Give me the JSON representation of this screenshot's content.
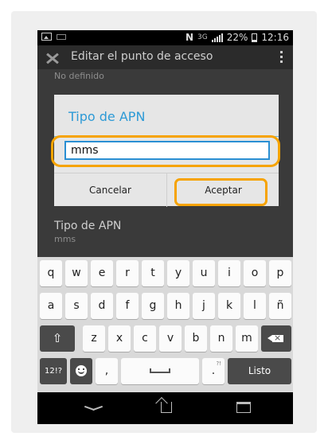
{
  "status_bar": {
    "network": "3G",
    "battery": "22%",
    "time": "12:16"
  },
  "app_bar": {
    "title": "Editar el punto de acceso",
    "icon": "wrench-screwdriver-icon"
  },
  "background": {
    "subtitle_text": "No definido",
    "list_item_title": "Tipo de APN",
    "list_item_value": "mms"
  },
  "dialog": {
    "title": "Tipo de APN",
    "input_value": "mms",
    "cancel_label": "Cancelar",
    "accept_label": "Aceptar"
  },
  "keyboard": {
    "row1": [
      "q",
      "w",
      "e",
      "r",
      "t",
      "y",
      "u",
      "i",
      "o",
      "p"
    ],
    "row2": [
      "a",
      "s",
      "d",
      "f",
      "g",
      "h",
      "j",
      "k",
      "l",
      "ñ"
    ],
    "row3": [
      "z",
      "x",
      "c",
      "v",
      "b",
      "n",
      "m"
    ],
    "symbols_label": "12!?",
    "comma_label": ",",
    "period_label": ".",
    "period_hint": "?!",
    "done_label": "Listo"
  },
  "colors": {
    "accent": "#2d9ad6",
    "highlight": "#f6a300"
  }
}
